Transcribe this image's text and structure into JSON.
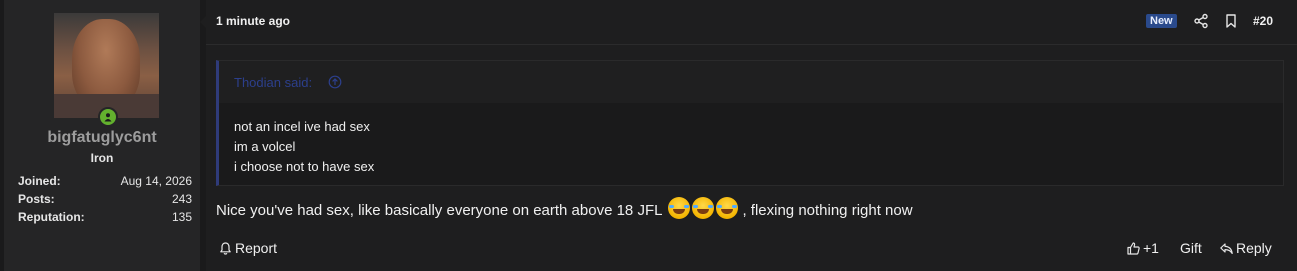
{
  "user": {
    "username": "bigfatuglyc6nt",
    "rank": "Iron",
    "stats": [
      {
        "label": "Joined:",
        "value": "Aug 14, 2026"
      },
      {
        "label": "Posts:",
        "value": "243"
      },
      {
        "label": "Reputation:",
        "value": "135"
      }
    ],
    "online_color": "#63b12e"
  },
  "header": {
    "time": "1 minute ago",
    "badge": "New",
    "post_number": "#20",
    "icons": [
      "share-icon",
      "bookmark-icon"
    ]
  },
  "quote": {
    "author": "Thodian said:",
    "lines": [
      "not an incel ive had sex",
      "im a volcel",
      "i choose not to have sex"
    ]
  },
  "message": {
    "before": "Nice you've had sex, like basically everyone on earth above 18 JFL",
    "emoji": "rolling-on-floor-laughing",
    "emoji_count": 3,
    "after": ", flexing nothing right now"
  },
  "footer": {
    "report": "Report",
    "like_count": "+1",
    "gift": "Gift",
    "reply": "Reply"
  }
}
